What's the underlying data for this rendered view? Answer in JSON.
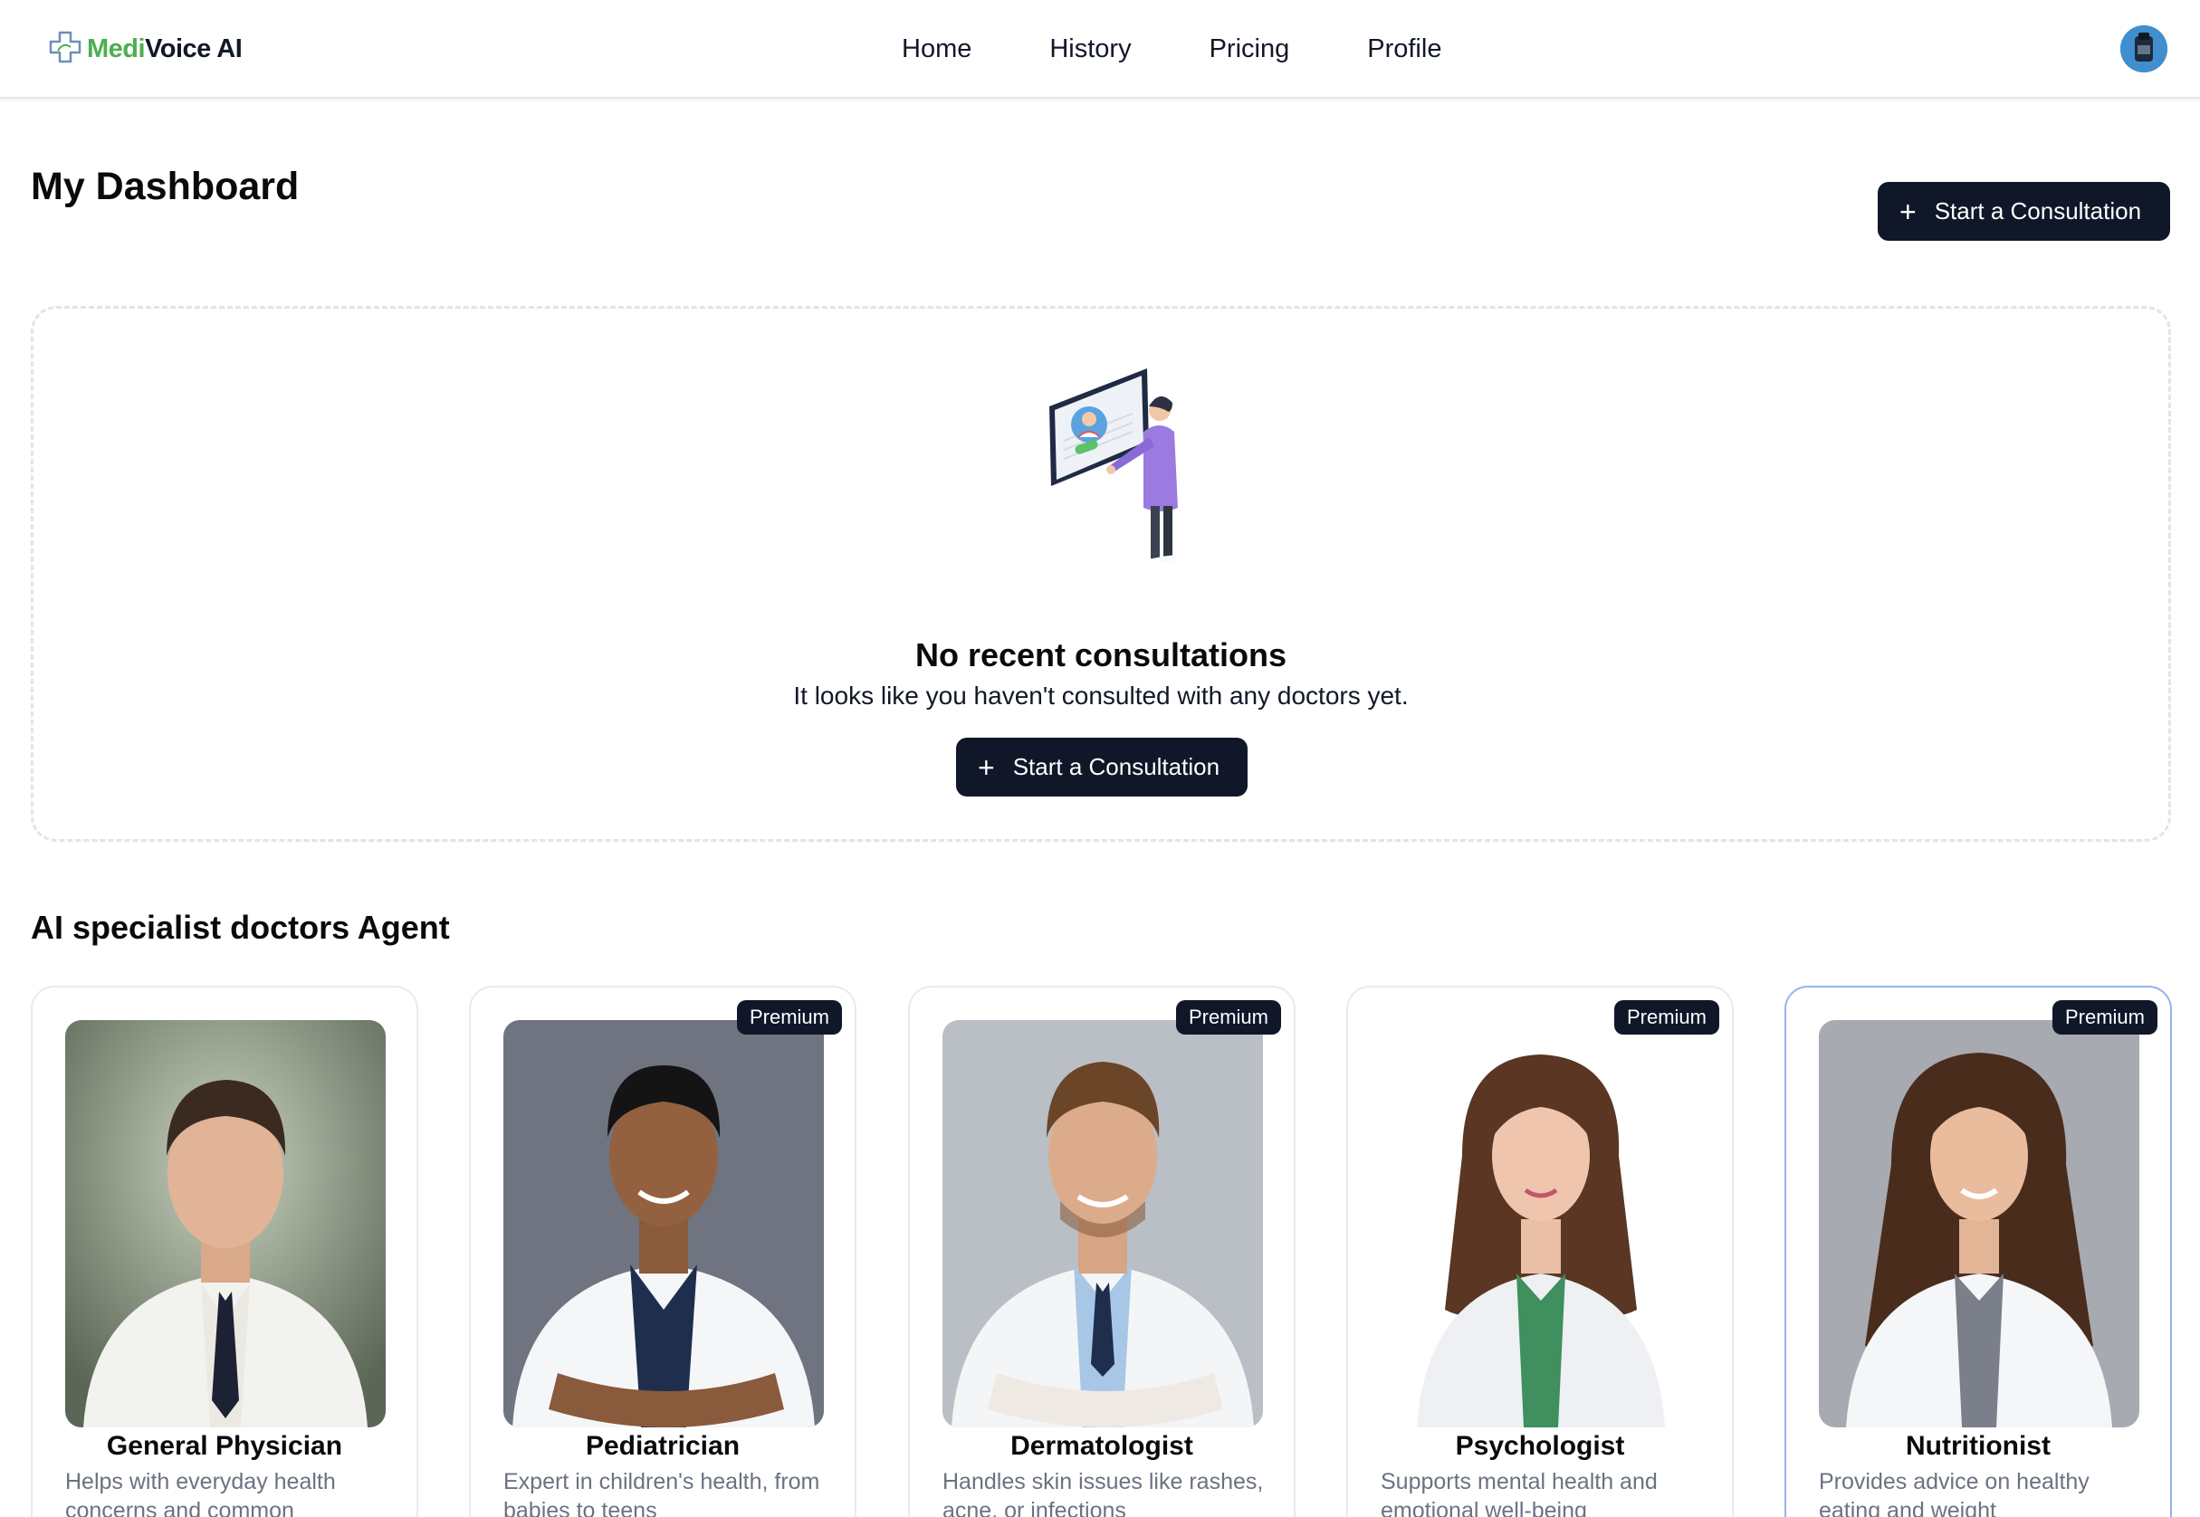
{
  "app": {
    "brand_part1": "Medi",
    "brand_part2": "Voice AI",
    "logo_icon": "medical-cross-icon"
  },
  "nav": {
    "items": [
      {
        "label": "Home"
      },
      {
        "label": "History"
      },
      {
        "label": "Pricing"
      },
      {
        "label": "Profile"
      }
    ]
  },
  "header": {
    "title": "My Dashboard",
    "start_button_label": "Start a Consultation"
  },
  "empty_state": {
    "illustration": "doctor-video-call-illustration",
    "title": "No recent consultations",
    "subtitle": "It looks like you haven't consulted with any doctors yet.",
    "button_label": "Start a Consultation"
  },
  "specialists": {
    "title": "AI specialist doctors Agent",
    "cards": [
      {
        "name": "General Physician",
        "desc": "Helps with everyday health concerns and common",
        "premium": false,
        "badge": ""
      },
      {
        "name": "Pediatrician",
        "desc": "Expert in children's health, from babies to teens",
        "premium": true,
        "badge": "Premium"
      },
      {
        "name": "Dermatologist",
        "desc": "Handles skin issues like rashes, acne, or infections",
        "premium": true,
        "badge": "Premium"
      },
      {
        "name": "Psychologist",
        "desc": "Supports mental health and emotional well-being",
        "premium": true,
        "badge": "Premium"
      },
      {
        "name": "Nutritionist",
        "desc": "Provides advice on healthy eating and weight",
        "premium": true,
        "badge": "Premium"
      }
    ]
  },
  "colors": {
    "brand_green": "#4caf50",
    "button_dark": "#0f1729",
    "highlight_border": "#93b4ec"
  }
}
